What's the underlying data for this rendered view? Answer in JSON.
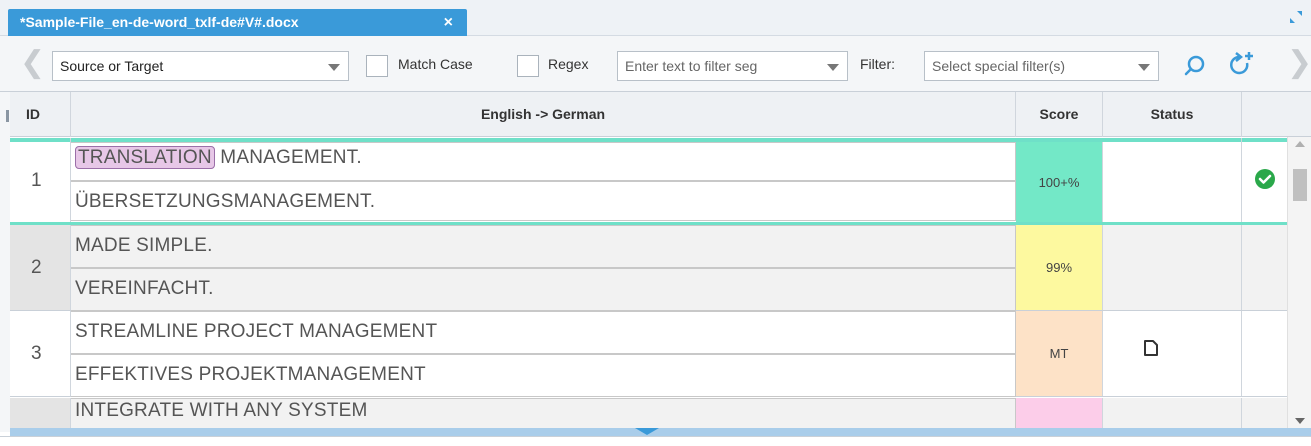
{
  "tab": {
    "title": "*Sample-File_en-de-word_txlf-de#V#.docx",
    "close_glyph": "×"
  },
  "toolbar": {
    "prev_glyph": "❮",
    "next_glyph": "❯",
    "search_scope": "Source or Target",
    "match_case_label": "Match Case",
    "regex_label": "Regex",
    "filter_text_placeholder": "Enter text to filter seg",
    "filter_label": "Filter:",
    "special_filter_placeholder": "Select special filter(s)"
  },
  "grid": {
    "columns": {
      "id": "ID",
      "language": "English -> German",
      "score": "Score",
      "status": "Status",
      "extra": ""
    },
    "rows": [
      {
        "id": "1",
        "source_highlight": "TRANSLATION",
        "source_rest": " MANAGEMENT.",
        "target": "ÜBERSETZUNGSMANAGEMENT.",
        "score": "100+%",
        "status_icon": "",
        "confirmed_icon": "check-circle-icon"
      },
      {
        "id": "2",
        "source": "MADE SIMPLE.",
        "target": "VEREINFACHT.",
        "score": "99%",
        "status_icon": "",
        "confirmed_icon": ""
      },
      {
        "id": "3",
        "source": "STREAMLINE PROJECT MANAGEMENT",
        "target": "EFFEKTIVES PROJEKTMANAGEMENT",
        "score": "MT",
        "status_icon": "document-icon",
        "confirmed_icon": ""
      },
      {
        "id": "",
        "source": "INTEGRATE WITH ANY SYSTEM",
        "target": "",
        "score": "",
        "status_icon": "",
        "confirmed_icon": ""
      }
    ]
  },
  "colors": {
    "tab_active": "#3a9ad9",
    "row_active_border": "#6fe0c8",
    "score_100": "#73e8c7",
    "score_99": "#fdf99f",
    "score_mt": "#fde2c7",
    "score_pink": "#fccde9",
    "highlight": "#e7c7e7",
    "confirmed_green": "#2aa84a"
  }
}
